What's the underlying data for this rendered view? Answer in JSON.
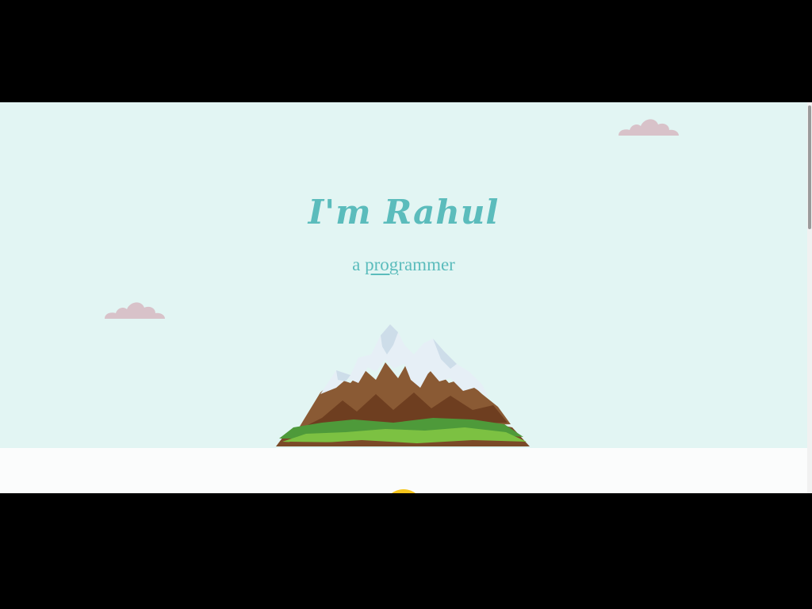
{
  "hero": {
    "title": "I'm Rahul",
    "subtitle_prefix": "a ",
    "subtitle_typed": "prog",
    "subtitle_rest": "rammer"
  },
  "colors": {
    "sky": "#e2f5f3",
    "accent_teal": "#5bbcbc",
    "cloud": "#d8c2c9",
    "lower_section": "#fbfcfc",
    "sun": "#f6c51c"
  },
  "icons": {
    "cloud": "cloud-icon",
    "mountain": "mountain-illustration",
    "sun": "sun-icon"
  }
}
